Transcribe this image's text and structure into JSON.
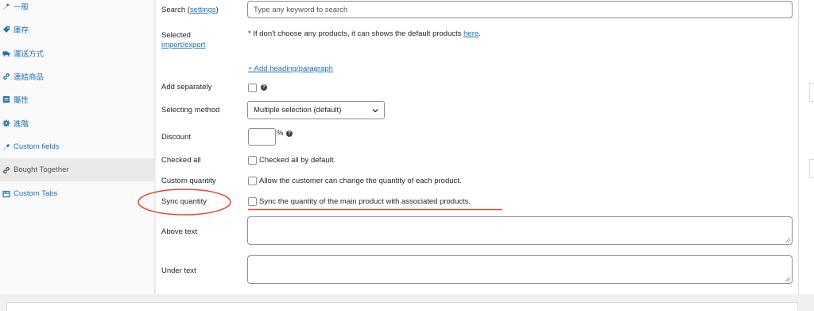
{
  "sidebar": {
    "items": [
      {
        "label": "一般",
        "icon": "wrench-icon"
      },
      {
        "label": "庫存",
        "icon": "tag-icon"
      },
      {
        "label": "運送方式",
        "icon": "truck-icon"
      },
      {
        "label": "連結商品",
        "icon": "link-icon"
      },
      {
        "label": "屬性",
        "icon": "list-icon"
      },
      {
        "label": "進階",
        "icon": "gear-icon"
      },
      {
        "label": "Custom fields",
        "icon": "wrench-icon"
      },
      {
        "label": "Bought Together",
        "icon": "link-icon"
      },
      {
        "label": "Custom Tabs",
        "icon": "tabs-icon"
      }
    ],
    "active_index": 7
  },
  "form": {
    "search": {
      "label": "Search (",
      "label_link": "settings",
      "label_close": ")",
      "placeholder": "Type any keyword to search"
    },
    "selected": {
      "label": "Selected",
      "label_link": "import/export",
      "note_prefix": "* If don't choose any products, it can shows the default products ",
      "note_link": "here",
      "note_suffix": ".",
      "add_heading": "+ Add heading/paragraph"
    },
    "add_separately": {
      "label": "Add separately",
      "checked": false
    },
    "selecting_method": {
      "label": "Selecting method",
      "value": "Multiple selection (default)"
    },
    "discount": {
      "label": "Discount",
      "unit": "%",
      "value": ""
    },
    "checked_all": {
      "label": "Checked all",
      "text": "Checked all by default.",
      "checked": false
    },
    "custom_quantity": {
      "label": "Custom quantity",
      "text": "Allow the customer can change the quantity of each product.",
      "checked": false
    },
    "sync_quantity": {
      "label": "Sync quantity",
      "text": "Sync the quantity of the main product with associated products.",
      "checked": false
    },
    "above_text": {
      "label": "Above text",
      "value": ""
    },
    "under_text": {
      "label": "Under text",
      "value": ""
    }
  },
  "colors": {
    "link": "#2271b1",
    "annotation": "#e8472a",
    "panel_bg": "#ffffff",
    "sidebar_bg": "#fafafa"
  }
}
